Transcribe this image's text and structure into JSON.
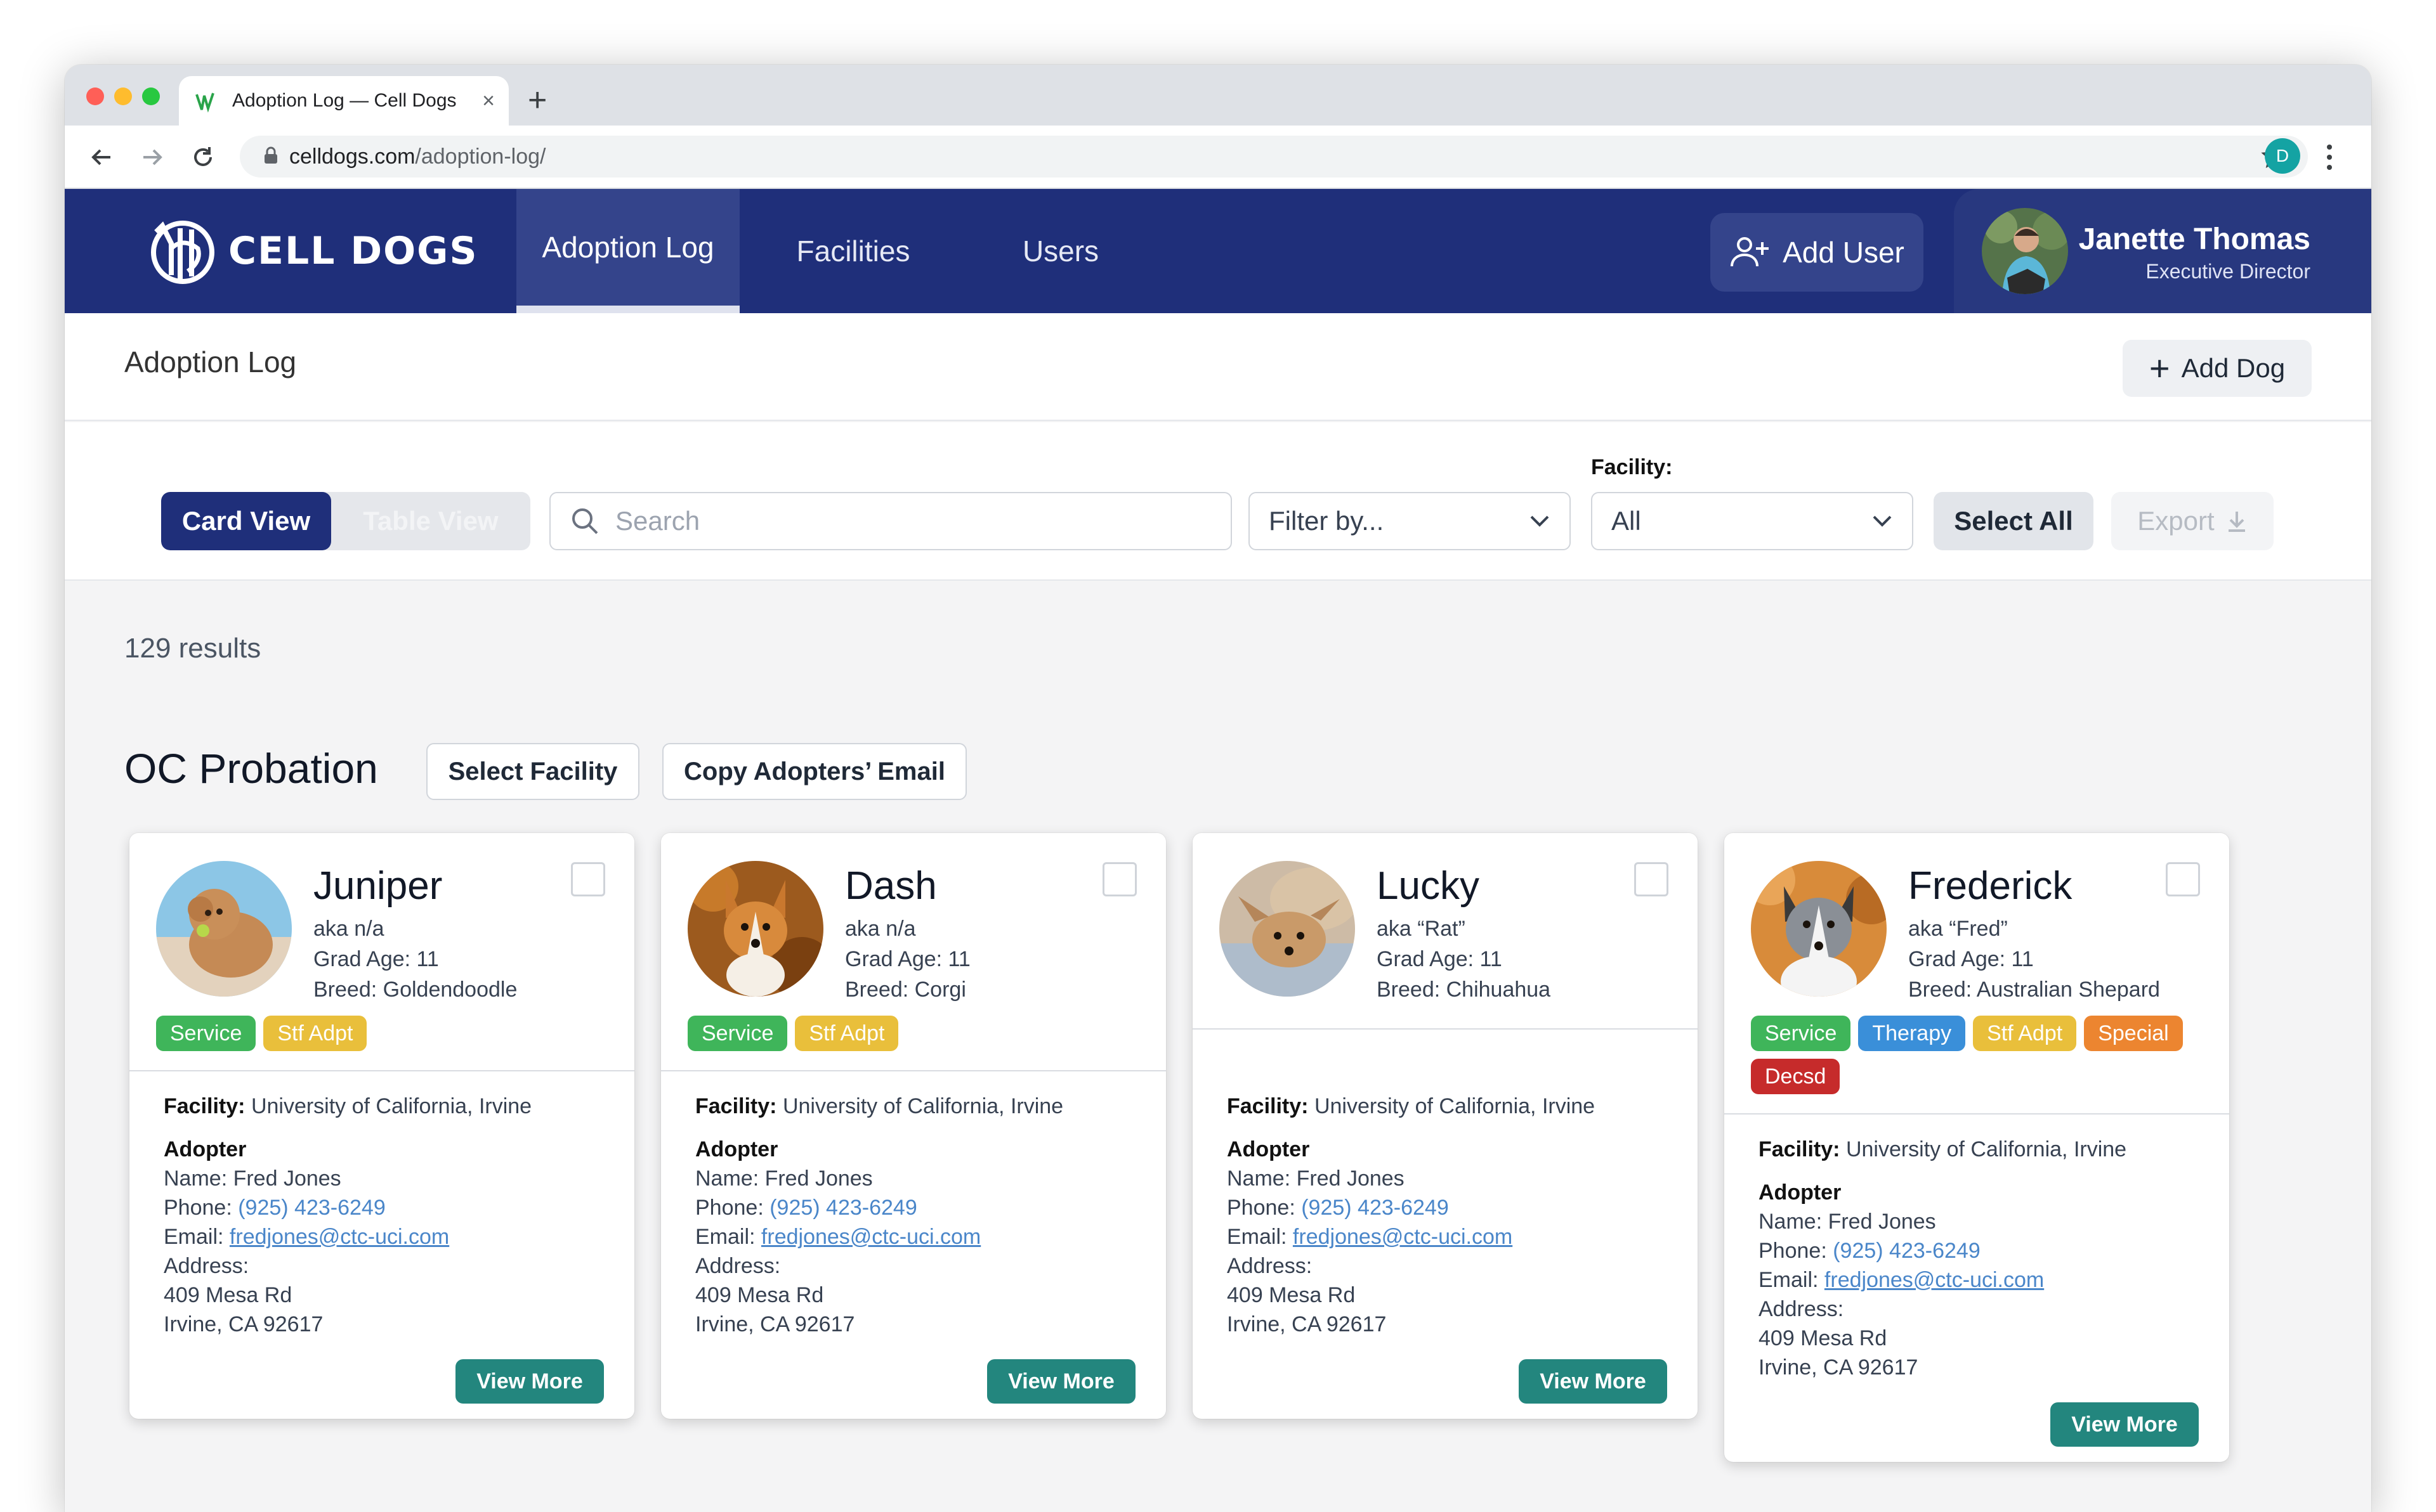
{
  "browser": {
    "tab_title": "Adoption Log — Cell Dogs",
    "tab_close": "×",
    "new_tab": "+",
    "url_domain": "celldogs.com",
    "url_path": "/adoption-log/",
    "profile_initial": "D"
  },
  "header": {
    "logo_text": "CELL DOGS",
    "nav": [
      "Adoption Log",
      "Facilities",
      "Users"
    ],
    "active_nav": "Adoption Log",
    "add_user_label": "Add User",
    "user_name": "Janette Thomas",
    "user_role": "Executive Director",
    "brand_color": "#1f2f7a"
  },
  "page": {
    "title": "Adoption Log",
    "add_dog_label": "Add Dog"
  },
  "filters": {
    "card_view_label": "Card View",
    "table_view_label": "Table View",
    "search_placeholder": "Search",
    "filter_by": "Filter by...",
    "facility_label": "Facility:",
    "facility_value": "All",
    "select_all_label": "Select All",
    "export_label": "Export"
  },
  "results_text": "129 results",
  "section": {
    "title": "OC Probation",
    "select_facility_label": "Select Facility",
    "copy_email_label": "Copy Adopters’ Email"
  },
  "labels": {
    "facility": "Facility:",
    "adopter": "Adopter",
    "name_prefix": "Name:",
    "phone_prefix": "Phone:",
    "email_prefix": "Email:",
    "address_prefix": "Address:",
    "view_more": "View More"
  },
  "tag_colors": {
    "Service": "#3fb55a",
    "Stf Adpt": "#e9bf3b",
    "Therapy": "#3a8fd9",
    "Special": "#ec8530",
    "Decsd": "#c62b2b"
  },
  "dogs": [
    {
      "name": "Juniper",
      "aka": "aka n/a",
      "grad_age": "Grad Age: 11",
      "breed": "Breed: Goldendoodle",
      "tags": [
        "Service",
        "Stf Adpt"
      ],
      "facility": "University of California, Irvine",
      "adopter_name": "Fred Jones",
      "phone": "(925) 423-6249",
      "email": "fredjones@ctc-uci.com",
      "address_line1": "409 Mesa Rd",
      "address_line2": "Irvine, CA 92617"
    },
    {
      "name": "Dash",
      "aka": "aka n/a",
      "grad_age": "Grad Age: 11",
      "breed": "Breed: Corgi",
      "tags": [
        "Service",
        "Stf Adpt"
      ],
      "facility": "University of California, Irvine",
      "adopter_name": "Fred Jones",
      "phone": "(925) 423-6249",
      "email": "fredjones@ctc-uci.com",
      "address_line1": "409 Mesa Rd",
      "address_line2": "Irvine, CA 92617"
    },
    {
      "name": "Lucky",
      "aka": "aka “Rat”",
      "grad_age": "Grad Age: 11",
      "breed": "Breed: Chihuahua",
      "tags": [],
      "facility": "University of California, Irvine",
      "adopter_name": "Fred Jones",
      "phone": "(925) 423-6249",
      "email": "fredjones@ctc-uci.com",
      "address_line1": "409 Mesa Rd",
      "address_line2": "Irvine, CA 92617"
    },
    {
      "name": "Frederick",
      "aka": "aka “Fred”",
      "grad_age": "Grad Age: 11",
      "breed": "Breed: Australian Shepard",
      "tags": [
        "Service",
        "Therapy",
        "Stf Adpt",
        "Special",
        "Decsd"
      ],
      "facility": "University of California, Irvine",
      "adopter_name": "Fred Jones",
      "phone": "(925) 423-6249",
      "email": "fredjones@ctc-uci.com",
      "address_line1": "409 Mesa Rd",
      "address_line2": "Irvine, CA 92617"
    }
  ]
}
